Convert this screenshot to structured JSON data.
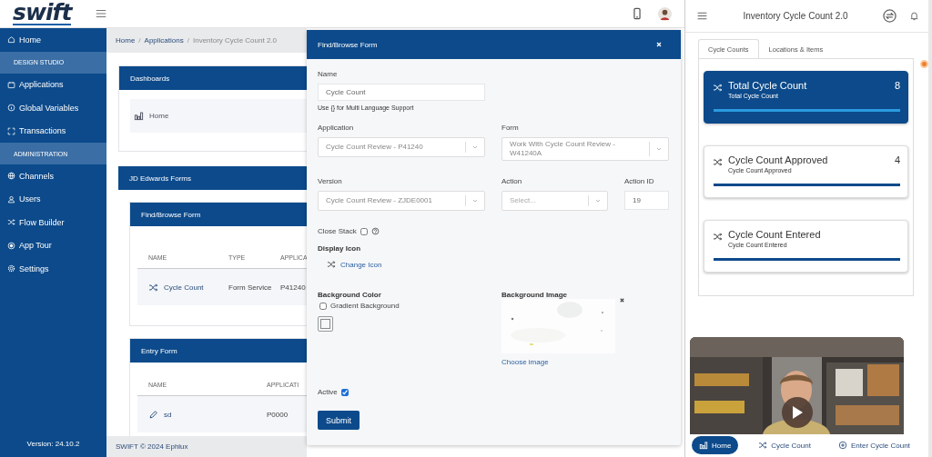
{
  "topbar": {
    "logo": "swift"
  },
  "sidebar": {
    "items": [
      {
        "kind": "item",
        "label": "Home"
      },
      {
        "kind": "section",
        "label": "DESIGN STUDIO"
      },
      {
        "kind": "item",
        "label": "Applications"
      },
      {
        "kind": "item",
        "label": "Global Variables"
      },
      {
        "kind": "item",
        "label": "Transactions"
      },
      {
        "kind": "section",
        "label": "ADMINISTRATION"
      },
      {
        "kind": "item",
        "label": "Channels"
      },
      {
        "kind": "item",
        "label": "Users"
      },
      {
        "kind": "item",
        "label": "Flow Builder"
      },
      {
        "kind": "item",
        "label": "App Tour"
      },
      {
        "kind": "item",
        "label": "Settings"
      }
    ],
    "version": "Version: 24.10.2"
  },
  "breadcrumb": {
    "items": [
      "Home",
      "Applications",
      "Inventory Cycle Count 2.0"
    ],
    "separator": "/"
  },
  "dashboards": {
    "title": "Dashboards",
    "items": [
      "Home"
    ]
  },
  "jde_forms": {
    "title": "JD Edwards Forms",
    "sections": [
      {
        "kind": "find",
        "title": "Find/Browse Form",
        "columns": [
          "NAME",
          "TYPE",
          "APPLICA"
        ],
        "rows": [
          [
            "Cycle Count",
            "Form Service",
            "P41240"
          ]
        ]
      },
      {
        "kind": "entry",
        "title": "Entry Form",
        "columns": [
          "NAME",
          "APPLICATI"
        ],
        "rows": [
          [
            "sd",
            "P0000"
          ]
        ]
      }
    ]
  },
  "footer": "SWIFT © 2024 Ephlux",
  "modal": {
    "title": "Find/Browse Form",
    "name": {
      "label": "Name",
      "value": "Cycle Count",
      "hint": "Use {} for Multi Language Support"
    },
    "application": {
      "label": "Application",
      "value": "Cycle Count Review - P41240"
    },
    "form": {
      "label": "Form",
      "value": "Work With Cycle Count Review - W41240A"
    },
    "version": {
      "label": "Version",
      "value": "Cycle Count Review - ZJDE0001"
    },
    "action": {
      "label": "Action",
      "placeholder": "Select..."
    },
    "action_id": {
      "label": "Action ID",
      "value": "19"
    },
    "close_stack": {
      "label": "Close Stack",
      "checked": false
    },
    "display_icon": {
      "label": "Display Icon",
      "link": "Change Icon"
    },
    "background_color": {
      "label": "Background Color",
      "gradient": {
        "label": "Gradient Background",
        "checked": false
      }
    },
    "background_image": {
      "label": "Background Image",
      "link": "Choose image"
    },
    "active": {
      "label": "Active",
      "checked": true
    },
    "submit": "Submit"
  },
  "phone": {
    "title": "Inventory Cycle Count 2.0",
    "tabs": [
      {
        "label": "Cycle Counts",
        "selected": true
      },
      {
        "label": "Locations & Items",
        "selected": false
      }
    ],
    "cards": [
      {
        "title": "Total Cycle Count",
        "subtitle": "Total Cycle Count",
        "count": "8",
        "selected": true
      },
      {
        "title": "Cycle Count Approved",
        "subtitle": "Cycle Count Approved",
        "count": "4",
        "selected": false
      },
      {
        "title": "Cycle Count Entered",
        "subtitle": "Cycle Count Entered",
        "selected": false
      }
    ],
    "nav": [
      {
        "label": "Home",
        "selected": true
      },
      {
        "label": "Cycle Count",
        "selected": false
      },
      {
        "label": "Enter Cycle Count",
        "selected": false
      }
    ]
  }
}
